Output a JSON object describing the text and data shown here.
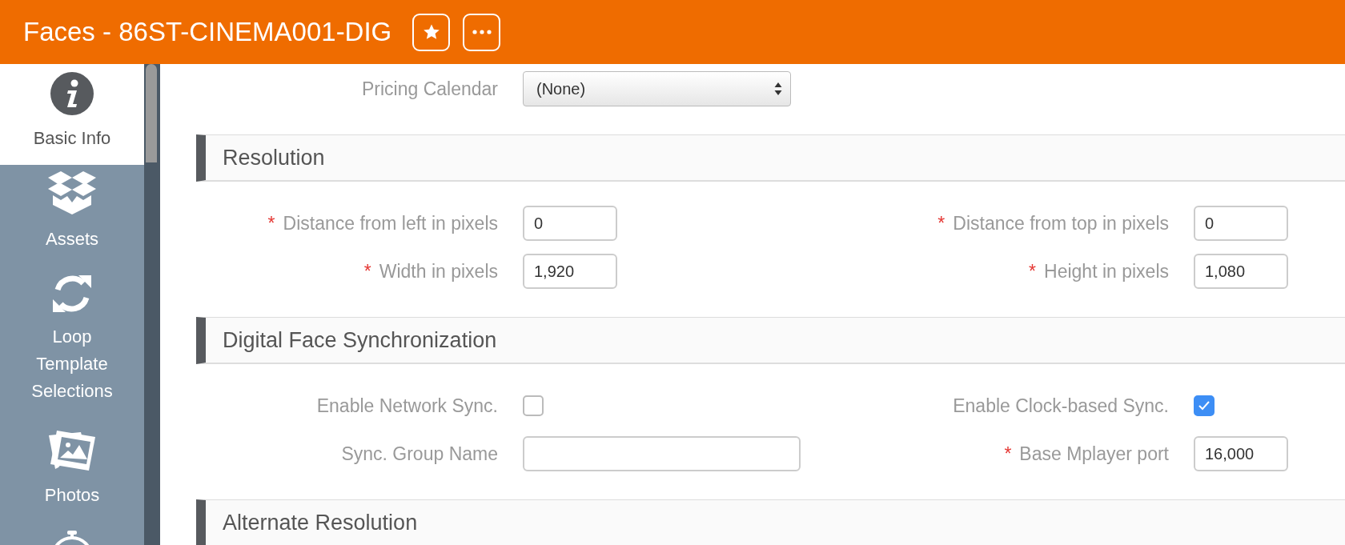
{
  "header": {
    "title": "Faces - 86ST-CINEMA001-DIG"
  },
  "sidebar": {
    "items": [
      {
        "label": "Basic Info",
        "selected": true
      },
      {
        "label": "Assets",
        "selected": false
      },
      {
        "label": "Loop Template Selections",
        "selected": false
      },
      {
        "label": "Photos",
        "selected": false
      },
      {
        "selected": false
      }
    ]
  },
  "top_field": {
    "label": "Pricing Calendar",
    "kind": "select",
    "value": "(None)"
  },
  "sections": [
    {
      "title": "Resolution",
      "rows": [
        [
          {
            "kind": "text",
            "required_mark": "*",
            "label": "Distance from left in pixels",
            "value": "0"
          },
          {
            "kind": "text",
            "required_mark": "*",
            "label": "Distance from top in pixels",
            "value": "0"
          }
        ],
        [
          {
            "kind": "text",
            "required_mark": "*",
            "label": "Width in pixels",
            "value": "1,920"
          },
          {
            "kind": "text",
            "required_mark": "*",
            "label": "Height in pixels",
            "value": "1,080"
          }
        ]
      ]
    },
    {
      "title": "Digital Face Synchronization",
      "rows": [
        [
          {
            "kind": "checkbox",
            "label": "Enable Network Sync.",
            "checked": false
          },
          {
            "kind": "checkbox",
            "label": "Enable Clock-based Sync.",
            "checked": true
          }
        ],
        [
          {
            "kind": "wide_text",
            "label": "Sync. Group Name"
          },
          {
            "kind": "text",
            "required_mark": "*",
            "label": "Base Mplayer port",
            "value": "16,000"
          }
        ]
      ]
    },
    {
      "title": "Alternate Resolution"
    }
  ]
}
